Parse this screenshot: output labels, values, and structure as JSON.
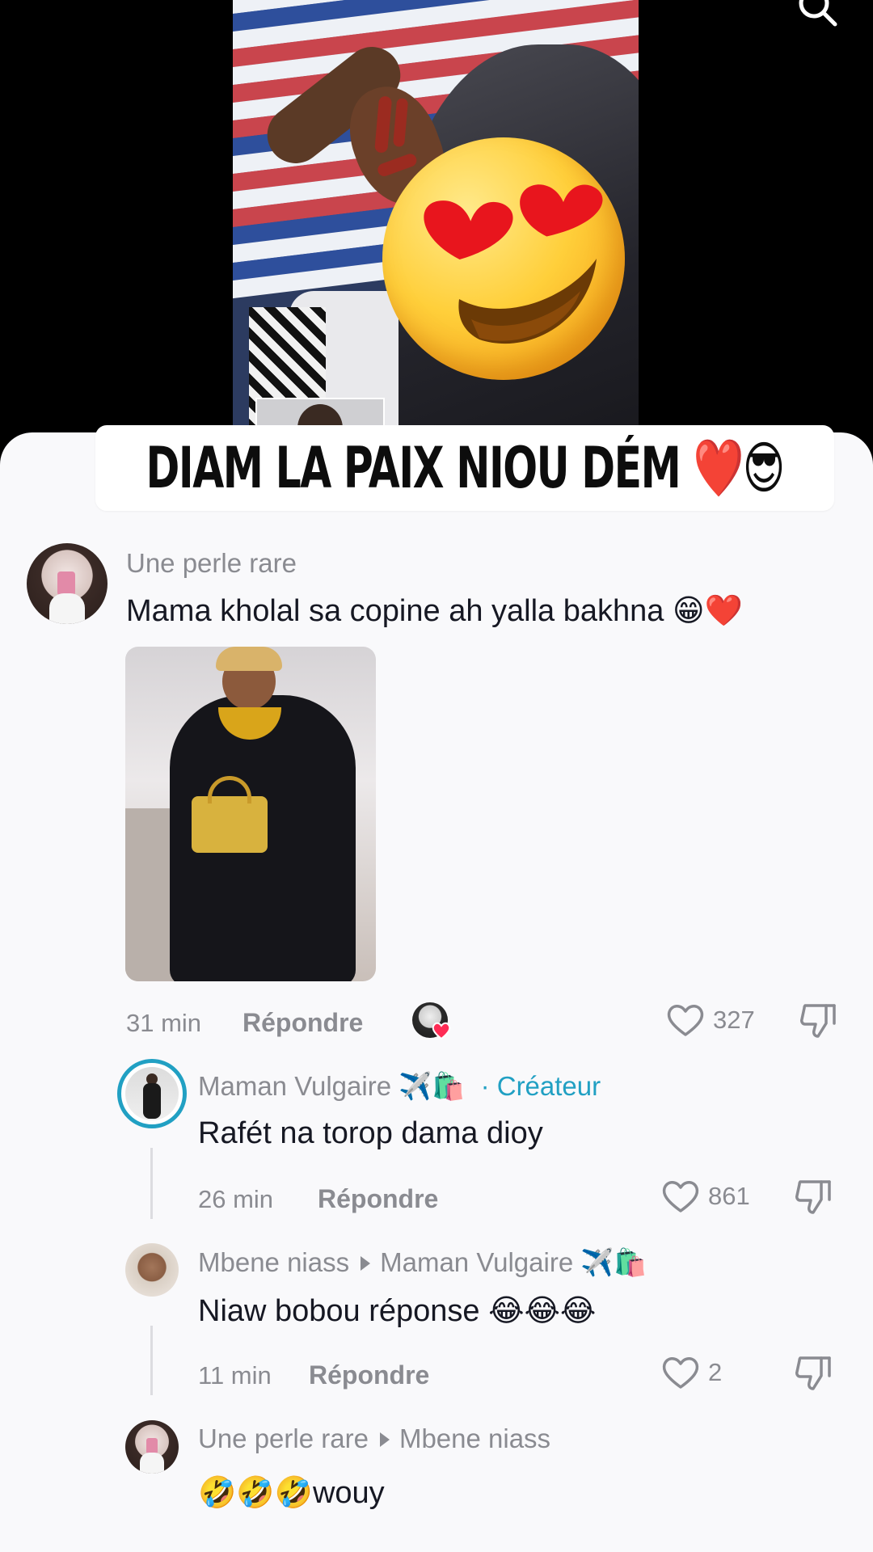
{
  "banner": {
    "text": "Diam la paix niou dém ❤️😎"
  },
  "comments": [
    {
      "username": "Une perle rare",
      "text": "Mama kholal sa copine ah yalla bakhna 😁❤️",
      "time": "31 min",
      "reply_label": "Répondre",
      "likes": "327"
    },
    {
      "username": "Maman Vulgaire ✈️🛍️",
      "creator_label": "· Créateur",
      "text": "Rafét na torop dama dioy",
      "time": "26 min",
      "reply_label": "Répondre",
      "likes": "861"
    },
    {
      "username": "Mbene niass",
      "reply_to": "Maman Vulgaire ✈️🛍️",
      "text": "Niaw bobou réponse 😂😂😂",
      "time": "11 min",
      "reply_label": "Répondre",
      "likes": "2"
    },
    {
      "username": "Une perle rare",
      "reply_to": "Mbene niass",
      "text": "🤣🤣🤣wouy"
    }
  ],
  "icons": {
    "search": "search-icon",
    "heart": "heart-outline-icon",
    "dislike": "thumbs-down-icon",
    "liked_by_creator": "creator-liked-icon"
  },
  "colors": {
    "accent": "#21a0c3",
    "muted": "#8a8b91",
    "text": "#161823",
    "heart": "#fe2c55"
  }
}
